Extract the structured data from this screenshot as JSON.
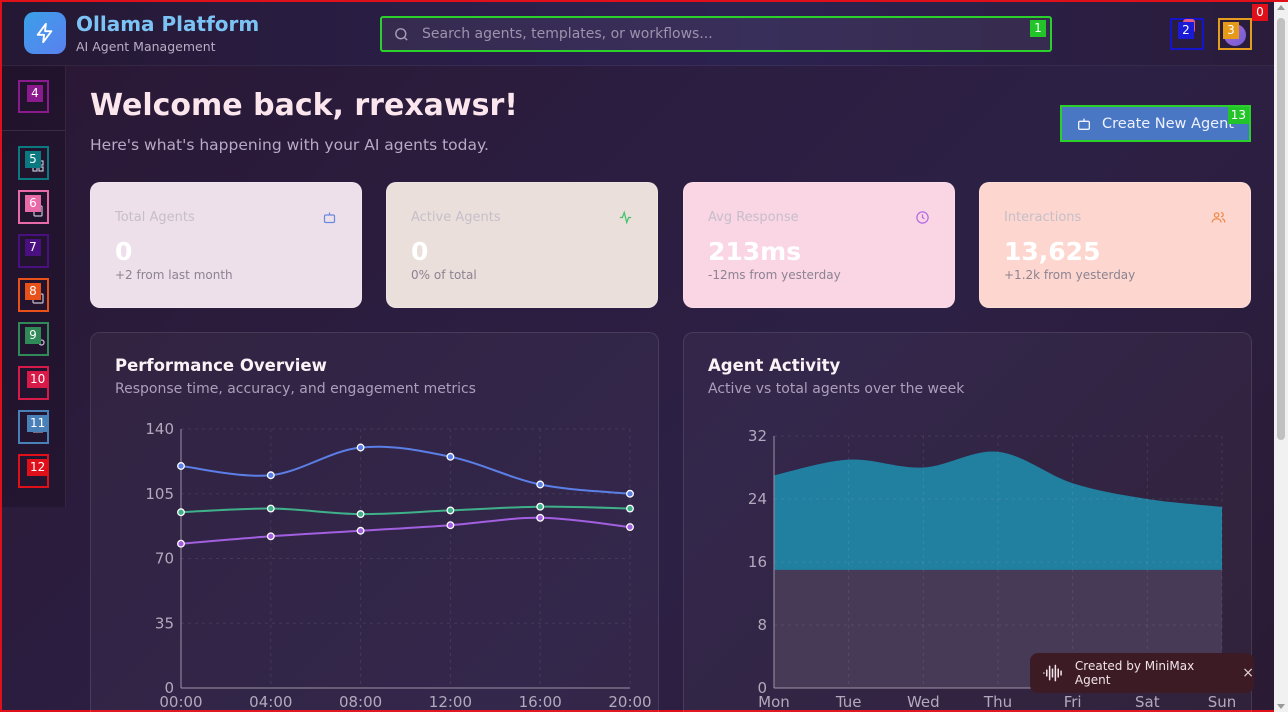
{
  "brand": {
    "title": "Ollama Platform",
    "subtitle": "AI Agent Management"
  },
  "search": {
    "placeholder": "Search agents, templates, or workflows..."
  },
  "markers": {
    "page": "0",
    "search": "1",
    "notifications": "2",
    "profile": "3",
    "sidebar_top": "4",
    "side": [
      "5",
      "6",
      "7",
      "8",
      "9",
      "10",
      "11",
      "12"
    ],
    "create": "13"
  },
  "welcome": {
    "title": "Welcome back, rrexawsr!",
    "subtitle": "Here's what's happening with your AI agents today."
  },
  "create_button": {
    "label": "Create New Agent"
  },
  "colors": {
    "marker_green": "#22c42a",
    "marker_blue": "#1b1bd6",
    "marker_orange": "#e69a1a",
    "marker_purple": "#8b1a8f",
    "marker_teal": "#0b7a80",
    "marker_pink": "#e86aa8",
    "marker_indigo": "#4a1080",
    "marker_orange2": "#e8521a",
    "marker_green2": "#2f8a58",
    "marker_crimson": "#d81a48",
    "marker_steel": "#4a80b8",
    "marker_red": "#e0101a"
  },
  "stats": [
    {
      "label": "Total Agents",
      "value": "0",
      "delta": "+2 from last month",
      "icon": "bot-icon",
      "color": "#6a8ae0",
      "bg": "#ede0ea"
    },
    {
      "label": "Active Agents",
      "value": "0",
      "delta": "0% of total",
      "icon": "activity-icon",
      "color": "#3ec46a",
      "bg": "#eadfdb"
    },
    {
      "label": "Avg Response",
      "value": "213ms",
      "delta": "-12ms from yesterday",
      "icon": "clock-icon",
      "color": "#b56ae6",
      "bg": "#fad5e4"
    },
    {
      "label": "Interactions",
      "value": "13,625",
      "delta": "+1.2k from yesterday",
      "icon": "users-icon",
      "color": "#ef8a4a",
      "bg": "#fdd7cf"
    }
  ],
  "performance": {
    "title": "Performance Overview",
    "subtitle": "Response time, accuracy, and engagement metrics"
  },
  "activity": {
    "title": "Agent Activity",
    "subtitle": "Active vs total agents over the week"
  },
  "toast": {
    "text": "Created by MiniMax Agent",
    "close": "×"
  },
  "chart_data": [
    {
      "type": "line",
      "title": "Performance Overview",
      "x": [
        "00:00",
        "04:00",
        "08:00",
        "12:00",
        "16:00",
        "20:00"
      ],
      "ylim": [
        0,
        140
      ],
      "yticks": [
        0,
        35,
        70,
        105,
        140
      ],
      "grid": true,
      "series": [
        {
          "values": [
            120,
            115,
            130,
            125,
            110,
            105
          ],
          "color": "#5b7fe6"
        },
        {
          "values": [
            95,
            97,
            94,
            96,
            98,
            97
          ],
          "color": "#3fb089"
        },
        {
          "values": [
            78,
            82,
            85,
            88,
            92,
            87
          ],
          "color": "#a260e0"
        }
      ]
    },
    {
      "type": "area",
      "title": "Agent Activity",
      "x": [
        "Mon",
        "Tue",
        "Wed",
        "Thu",
        "Fri",
        "Sat",
        "Sun"
      ],
      "ylim": [
        0,
        32
      ],
      "yticks": [
        0,
        8,
        16,
        24,
        32
      ],
      "grid": true,
      "series": [
        {
          "values": [
            27,
            29,
            28,
            30,
            26,
            24,
            23
          ],
          "color": "#1f8fb0"
        },
        {
          "values": [
            15,
            15,
            15,
            15,
            15,
            15,
            15
          ],
          "color": "#4a3752"
        }
      ]
    }
  ]
}
